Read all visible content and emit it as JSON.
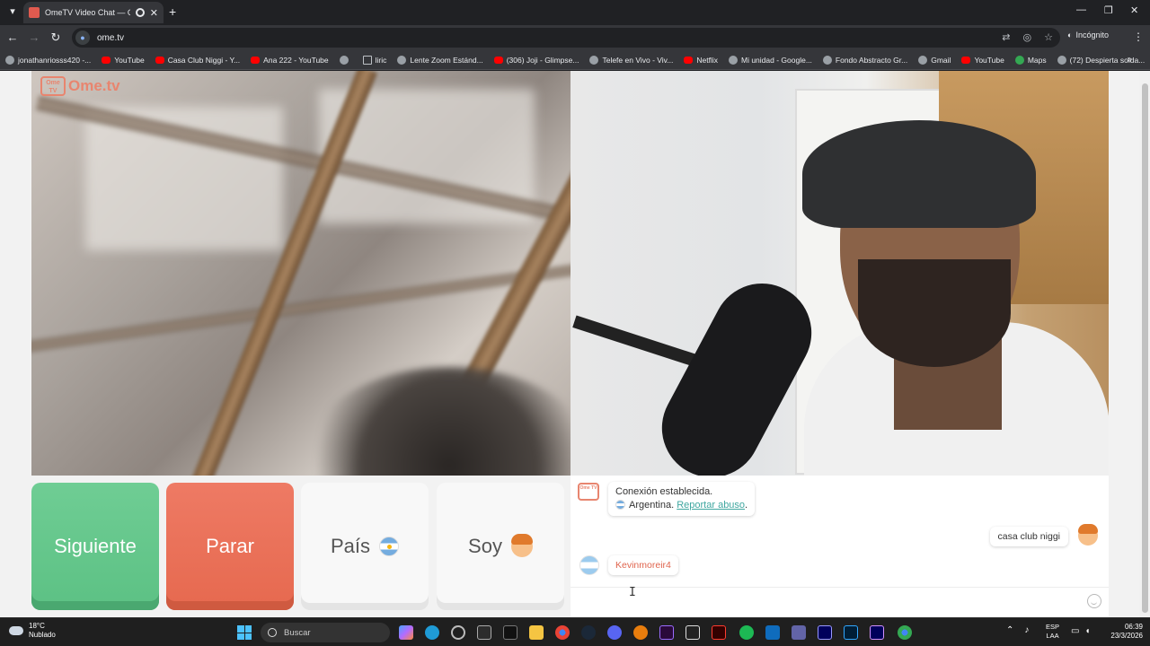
{
  "browser": {
    "tab_title": "OmeTV Video Chat — Ome",
    "url": "ome.tv",
    "mode_label": "Incógnito",
    "bookmarks": [
      {
        "label": "jonathanriosss420 -...",
        "icon": "globe-icon"
      },
      {
        "label": "YouTube",
        "icon": "youtube-icon"
      },
      {
        "label": "Casa Club Niggi - Y...",
        "icon": "youtube-icon"
      },
      {
        "label": "Ana 222 - YouTube",
        "icon": "youtube-icon"
      },
      {
        "label": "",
        "icon": "globe-icon"
      },
      {
        "label": "liric",
        "icon": "folder-icon"
      },
      {
        "label": "Lente Zoom Estánd...",
        "icon": "globe-icon"
      },
      {
        "label": "(306) Joji - Glimpse...",
        "icon": "youtube-icon"
      },
      {
        "label": "Telefe en Vivo - Viv...",
        "icon": "globe-icon"
      },
      {
        "label": "Netflix",
        "icon": "netflix-icon"
      },
      {
        "label": "Mi unidad - Google...",
        "icon": "globe-icon"
      },
      {
        "label": "Fondo Abstracto Gr...",
        "icon": "globe-icon"
      },
      {
        "label": "Gmail",
        "icon": "globe-icon"
      },
      {
        "label": "YouTube",
        "icon": "youtube-icon"
      },
      {
        "label": "Maps",
        "icon": "maps-icon"
      },
      {
        "label": "(72) Despierta solda...",
        "icon": "globe-icon"
      }
    ]
  },
  "site": {
    "logo_badge": "Ome TV",
    "logo_text": "Ome.tv"
  },
  "controls": {
    "next_label": "Siguiente",
    "stop_label": "Parar",
    "country_label": "País",
    "gender_label": "Soy"
  },
  "chat": {
    "system_avatar": "Ome TV",
    "connected_text": "Conexión establecida.",
    "country_text": "Argentina.",
    "report_link": "Reportar abuso",
    "report_suffix": ".",
    "my_message": "casa club niggi",
    "peer_name": "Kevinmoreir4",
    "input_value": ""
  },
  "taskbar": {
    "temperature": "18°C",
    "weather": "Nublado",
    "search_placeholder": "Buscar",
    "lang_top": "ESP",
    "lang_bottom": "LAA",
    "time": "06:39",
    "date": "23/3/2026"
  },
  "colors": {
    "next_button": "#5cc184",
    "stop_button": "#e6694f",
    "brand": "#e8856f",
    "link": "#3fa7a0"
  }
}
